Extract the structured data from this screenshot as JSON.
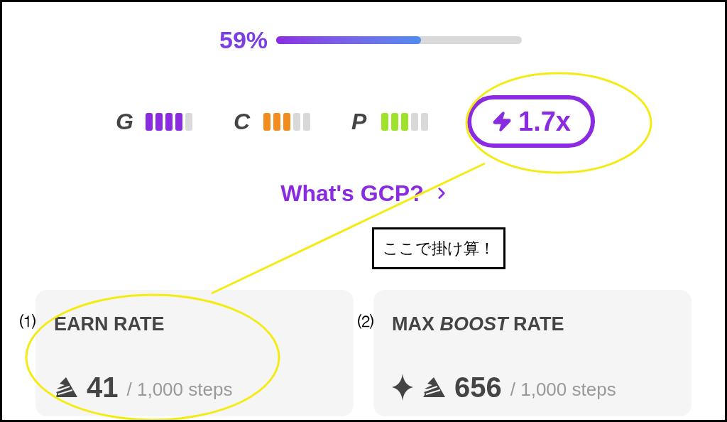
{
  "progress": {
    "label": "59%",
    "level": 0.59
  },
  "stats": [
    {
      "letter": "G",
      "level": 0.8,
      "color": "#8a2be2"
    },
    {
      "letter": "C",
      "level": 0.6,
      "color": "#f28c1e"
    },
    {
      "letter": "P",
      "level": 0.6,
      "color": "#9ee22c"
    }
  ],
  "boost": {
    "label": "1.7x"
  },
  "link": {
    "label": "What's GCP?"
  },
  "callout": {
    "text": "ここで掛け算！"
  },
  "cards": [
    {
      "kind": "earn",
      "marker": "⑴",
      "title": "EARN RATE",
      "value": "41",
      "unit": "/ 1,000 steps"
    },
    {
      "kind": "boost",
      "marker": "⑵",
      "title": "MAX *BOOST* RATE",
      "value": "656",
      "unit": "/ 1,000 steps"
    }
  ]
}
